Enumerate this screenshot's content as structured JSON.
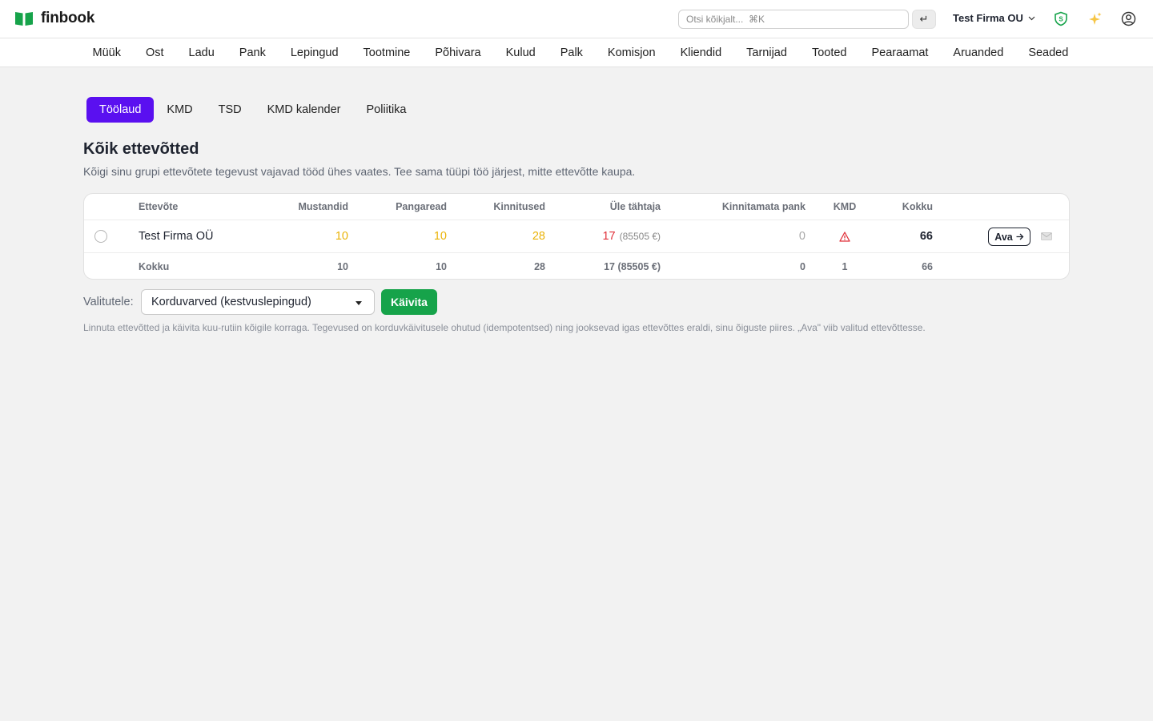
{
  "app": {
    "name": "finbook"
  },
  "search": {
    "placeholder": "Otsi kõikjalt...  ⌘K",
    "enter_symbol": "↵"
  },
  "header": {
    "company": "Test Firma OU"
  },
  "nav": [
    "Müük",
    "Ost",
    "Ladu",
    "Pank",
    "Lepingud",
    "Tootmine",
    "Põhivara",
    "Kulud",
    "Palk",
    "Komisjon",
    "Kliendid",
    "Tarnijad",
    "Tooted",
    "Pearaamat",
    "Aruanded",
    "Seaded"
  ],
  "subtabs": [
    {
      "label": "Töölaud",
      "active": true
    },
    {
      "label": "KMD"
    },
    {
      "label": "TSD"
    },
    {
      "label": "KMD kalender"
    },
    {
      "label": "Poliitika"
    }
  ],
  "page": {
    "title": "Kõik ettevõtted",
    "description": "Kõigi sinu grupi ettevõtete tegevust vajavad tööd ühes vaates. Tee sama tüüpi töö järjest, mitte ettevõtte kaupa."
  },
  "table": {
    "columns": {
      "company": "Ettevõte",
      "drafts": "Mustandid",
      "bank_rows": "Pangaread",
      "confirmations": "Kinnitused",
      "overdue": "Üle tähtaja",
      "unconfirmed_bank": "Kinnitamata pank",
      "kmd": "KMD",
      "total": "Kokku"
    },
    "rows": [
      {
        "company": "Test Firma OÜ",
        "drafts": "10",
        "bank_rows": "10",
        "confirmations": "28",
        "overdue": "17",
        "overdue_amount": "(85505 €)",
        "unconfirmed_bank": "0",
        "total": "66",
        "open_label": "Ava"
      }
    ],
    "totals": {
      "label": "Kokku",
      "drafts": "10",
      "bank_rows": "10",
      "confirmations": "28",
      "overdue": "17 (85505 €)",
      "unconfirmed_bank": "0",
      "kmd": "1",
      "total": "66"
    }
  },
  "bulk": {
    "label": "Valitutele:",
    "selected_action": "Korduvarved (kestvuslepingud)",
    "run_label": "Käivita",
    "help": "Linnuta ettevõtted ja käivita kuu-rutiin kõigile korraga. Tegevused on korduvkäivitusele ohutud (idempotentsed) ning jooksevad igas ettevõttes eraldi, sinu õiguste piires. „Ava\" viib valitud ettevõttesse."
  },
  "colors": {
    "accent": "#5a10f0",
    "success": "#16a34a",
    "warning": "#eab308",
    "danger": "#e0313a"
  }
}
